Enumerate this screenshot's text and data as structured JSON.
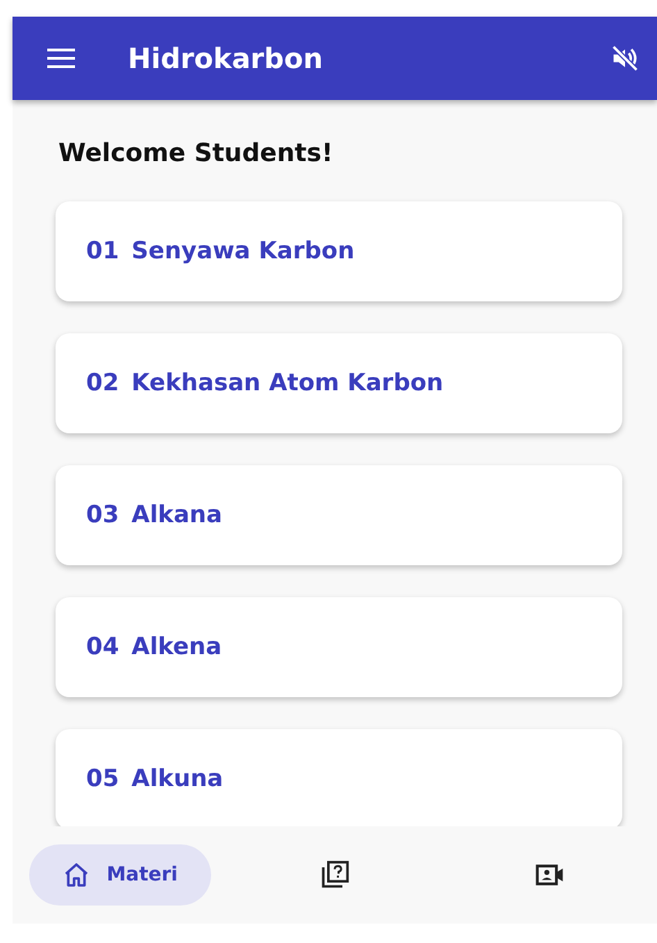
{
  "app_bar": {
    "title": "Hidrokarbon",
    "sound_muted": true
  },
  "greeting": "Welcome Students!",
  "topics": [
    {
      "number": "01",
      "title": "Senyawa Karbon"
    },
    {
      "number": "02",
      "title": "Kekhasan Atom Karbon"
    },
    {
      "number": "03",
      "title": "Alkana"
    },
    {
      "number": "04",
      "title": "Alkena"
    },
    {
      "number": "05",
      "title": "Alkuna"
    }
  ],
  "bottom_nav": [
    {
      "label": "Materi",
      "selected": true
    },
    {
      "selected": false
    },
    {
      "selected": false
    }
  ]
}
